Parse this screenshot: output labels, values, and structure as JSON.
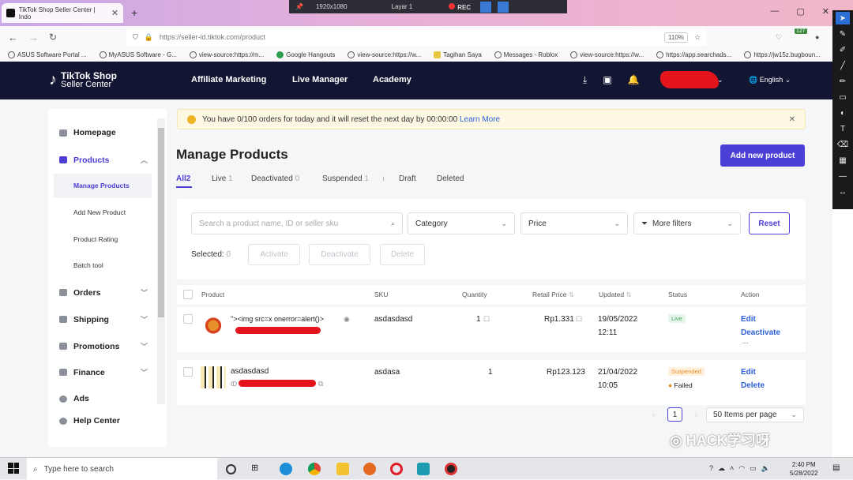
{
  "browser": {
    "tab_title": "TikTok Shop Seller Center | Indo",
    "rec_bar": {
      "resolution": "1920x1080",
      "layer": "Layar 1",
      "rec": "REC"
    },
    "url": "https://seller-id.tiktok.com/product",
    "zoom": "110%",
    "badge_count": "127",
    "bookmarks": [
      "ASUS Software Portal ...",
      "MyASUS Software - G...",
      "view-source:https://m...",
      "Google Hangouts",
      "view-source:https://w...",
      "Tagihan Saya",
      "Messages - Roblox",
      "view-source:https://w...",
      "https://app.searchads...",
      "https://jw15z.bugboun..."
    ]
  },
  "header": {
    "logo_line1": "TikTok Shop",
    "logo_line2": "Seller Center",
    "nav": [
      "Affiliate Marketing",
      "Live Manager",
      "Academy"
    ],
    "language": "English"
  },
  "sidebar": {
    "items": [
      {
        "label": "Homepage"
      },
      {
        "label": "Products"
      },
      {
        "label": "Orders"
      },
      {
        "label": "Shipping"
      },
      {
        "label": "Promotions"
      },
      {
        "label": "Finance"
      },
      {
        "label": "Ads"
      },
      {
        "label": "Help Center"
      }
    ],
    "sub_items": [
      "Manage Products",
      "Add New Product",
      "Product Rating",
      "Batch tool"
    ]
  },
  "notice": {
    "text": "You have 0/100 orders for today and it will reset the next day by 00:00:00",
    "link": "Learn More"
  },
  "page": {
    "title": "Manage Products",
    "add_button": "Add new product",
    "tabs": [
      {
        "label": "All",
        "count": "2"
      },
      {
        "label": "Live",
        "count": "1"
      },
      {
        "label": "Deactivated",
        "count": "0"
      },
      {
        "label": "Suspended",
        "count": "1"
      },
      {
        "label": "Draft",
        "count": ""
      },
      {
        "label": "Deleted",
        "count": ""
      }
    ]
  },
  "filters": {
    "search_placeholder": "Search a product name, ID or seller sku",
    "category": "Category",
    "price": "Price",
    "more_filters": "More filters",
    "reset": "Reset",
    "selected_label": "Selected:",
    "selected_count": "0",
    "activate": "Activate",
    "deactivate": "Deactivate",
    "delete": "Delete"
  },
  "table": {
    "columns": [
      "Product",
      "SKU",
      "Quantity",
      "Retail Price",
      "Updated",
      "Status",
      "Action"
    ],
    "rows": [
      {
        "name": "\"><img src=x onerror=alert()>",
        "sku": "asdasdasd",
        "quantity": "1",
        "price": "Rp1.331",
        "date": "19/05/2022",
        "time": "12:11",
        "status": "Live",
        "action1": "Edit",
        "action2": "Deactivate",
        "more": "..."
      },
      {
        "name": "asdasdasd",
        "id_label": "ID",
        "sku": "asdasa",
        "quantity": "1",
        "price": "Rp123.123",
        "date": "21/04/2022",
        "time": "10:05",
        "status": "Suspended",
        "substatus": "Failed",
        "action1": "Edit",
        "action2": "Delete"
      }
    ]
  },
  "pagination": {
    "current": "1",
    "per_page": "50 Items per page"
  },
  "watermark": "HACK学习呀",
  "taskbar": {
    "search": "Type here to search",
    "time": "2:40 PM",
    "date": "5/28/2022"
  },
  "colors": {
    "accent": "#4b3fd6",
    "header": "#131633",
    "live": "#3aa757",
    "suspended": "#f08c1e",
    "redaction": "#e5161b"
  }
}
